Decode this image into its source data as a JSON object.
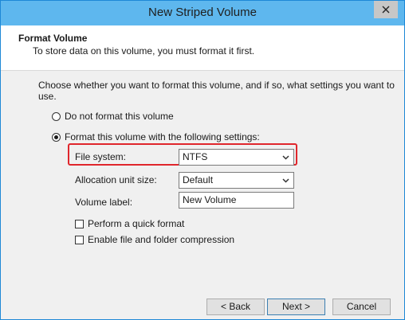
{
  "window": {
    "title": "New Striped Volume"
  },
  "header": {
    "title": "Format Volume",
    "subtitle": "To store data on this volume, you must format it first."
  },
  "instructions": "Choose whether you want to format this volume, and if so, what settings you want to use.",
  "options": {
    "no_format_label": "Do not format this volume",
    "format_label": "Format this volume with the following settings:"
  },
  "settings": {
    "file_system_label": "File system:",
    "file_system_value": "NTFS",
    "alloc_label": "Allocation unit size:",
    "alloc_value": "Default",
    "volume_label_label": "Volume label:",
    "volume_label_value": "New Volume",
    "quick_format_label": "Perform a quick format",
    "compression_label": "Enable file and folder compression"
  },
  "buttons": {
    "back": "< Back",
    "next": "Next >",
    "cancel": "Cancel"
  },
  "colors": {
    "titlebar": "#5eb7ee",
    "highlight": "#e0262c"
  },
  "icons": [
    "close-icon",
    "chevron-down-icon"
  ]
}
